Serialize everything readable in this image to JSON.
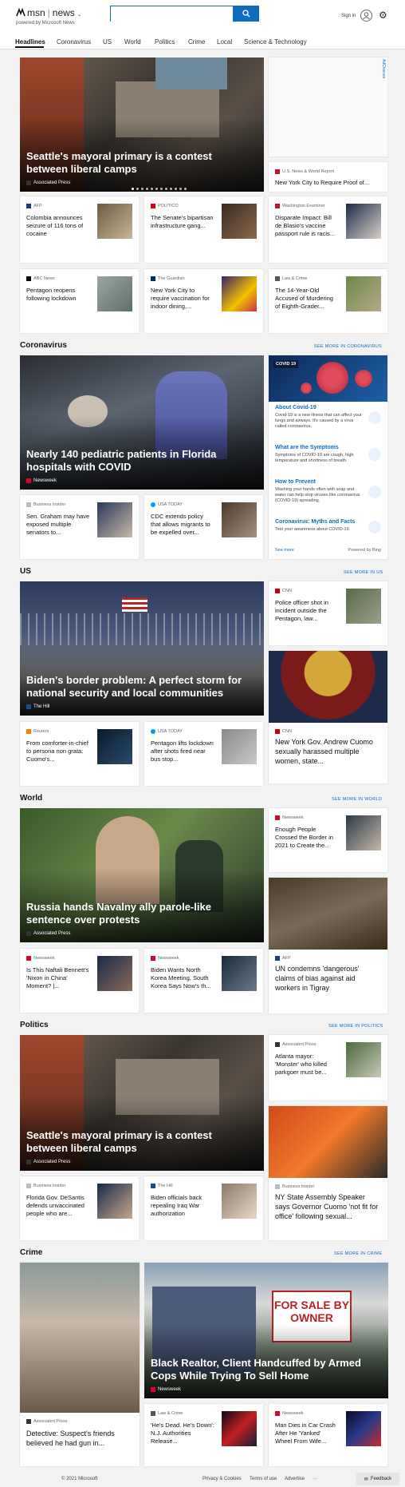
{
  "header": {
    "brand": "msn",
    "section": "news",
    "tagline": "powered by Microsoft News",
    "search_placeholder": "",
    "sign_in": "Sign in"
  },
  "nav": [
    "Headlines",
    "Coronavirus",
    "US",
    "World",
    "Politics",
    "Crime",
    "Local",
    "Science & Technology"
  ],
  "ad_label": "AdChoices",
  "headlines": {
    "hero": {
      "title": "Seattle's mayoral primary is a contest between liberal camps",
      "source": "Associated Press"
    },
    "side": {
      "source": "U.S. News & World Report",
      "title": "New York City to Require Proof of..."
    },
    "row1": [
      {
        "source": "AFP",
        "title": "Colombia announces seizure of 116 tons of cocaine"
      },
      {
        "source": "POLITICO",
        "title": "The Senate's bipartisan infrastructure gang..."
      },
      {
        "source": "Washington Examiner",
        "title": "Disparate Impact: Bill de Blasio's vaccine passport rule is racis..."
      }
    ],
    "row2": [
      {
        "source": "ABC News",
        "title": "Pentagon reopens following lockdown"
      },
      {
        "source": "The Guardian",
        "title": "New York City to require vaccination for indoor dining,..."
      },
      {
        "source": "Law & Crime",
        "title": "The 14-Year-Old Accused of Murdering of Eighth-Grader..."
      }
    ]
  },
  "coronavirus": {
    "heading": "Coronavirus",
    "more": "SEE MORE IN CORONAVIRUS",
    "hero": {
      "title": "Nearly 140 pediatric patients in Florida hospitals with COVID",
      "source": "Newsweek"
    },
    "row": [
      {
        "source": "Business Insider",
        "title": "Sen. Graham may have exposed multiple senators to..."
      },
      {
        "source": "USA TODAY",
        "title": "CDC extends policy that allows migrants to be expelled over..."
      }
    ],
    "panel": {
      "tag": "COVID 19",
      "items": [
        {
          "h": "About Covid-19",
          "d": "Covid-19 is a new illness that can affect your lungs and airways. It's caused by a virus called coronavirus."
        },
        {
          "h": "What are the Symptoms",
          "d": "Symptoms of COVID-19 are cough, high temperature and shortness of breath."
        },
        {
          "h": "How to Prevent",
          "d": "Washing your hands often with soap and water can help stop viruses like coronavirus (COVID-19) spreading."
        },
        {
          "h": "Coronavirus: Myths and Facts",
          "d": "Test your awareness about COVID-19."
        }
      ],
      "see_more": "See more",
      "powered": "Powered by Bing"
    }
  },
  "us": {
    "heading": "US",
    "more": "SEE MORE IN US",
    "hero": {
      "title": "Biden's border problem: A perfect storm for national security and local communities",
      "source": "The Hill"
    },
    "side1": {
      "source": "CNN",
      "title": "Police officer shot in incident outside the Pentagon, law..."
    },
    "side2": {
      "source": "CNN",
      "title": "New York Gov. Andrew Cuomo sexually harassed multiple women, state..."
    },
    "row": [
      {
        "source": "Reuters",
        "title": "From comforter-in-chief to persona non grata: Cuomo's..."
      },
      {
        "source": "USA TODAY",
        "title": "Pentagon lifts lockdown after shots fired near bus stop..."
      }
    ]
  },
  "world": {
    "heading": "World",
    "more": "SEE MORE IN WORLD",
    "hero": {
      "title": "Russia hands Navalny ally parole-like sentence over protests",
      "source": "Associated Press"
    },
    "side1": {
      "source": "Newsweek",
      "title": "Enough People Crossed the Border in 2021 to Create the..."
    },
    "side2": {
      "source": "AFP",
      "title": "UN condemns 'dangerous' claims of bias against aid workers in Tigray"
    },
    "row": [
      {
        "source": "Newsweek",
        "title": "Is This Naftali Bennett's 'Nixon in China' Moment? |..."
      },
      {
        "source": "Newsweek",
        "title": "Biden Wants North Korea Meeting, South Korea Says Now's th..."
      }
    ]
  },
  "politics": {
    "heading": "Politics",
    "more": "SEE MORE IN POLITICS",
    "hero": {
      "title": "Seattle's mayoral primary is a contest between liberal camps",
      "source": "Associated Press"
    },
    "side1": {
      "source": "Associated Press",
      "title": "Atlanta mayor: 'Monster' who killed parkgoer must be..."
    },
    "side2": {
      "source": "Business Insider",
      "title": "NY State Assembly Speaker says Governor Cuomo 'not fit for office' following sexual..."
    },
    "row": [
      {
        "source": "Business Insider",
        "title": "Florida Gov. DeSantis defends unvaccinated people who are..."
      },
      {
        "source": "The Hill",
        "title": "Biden officials back repealing Iraq War authorization"
      }
    ]
  },
  "crime": {
    "heading": "Crime",
    "more": "SEE MORE IN CRIME",
    "left": {
      "source": "Associated Press",
      "title": "Detective: Suspect's friends believed he had gun in..."
    },
    "hero": {
      "title": "Black Realtor, Client Handcuffed by Armed Cops While Trying To Sell Home",
      "source": "Newsweek"
    },
    "sign": "FOR SALE BY OWNER",
    "row": [
      {
        "source": "Law & Crime",
        "title": "'He's Dead. He's Down': N.J. Authorities Release..."
      },
      {
        "source": "Newsweek",
        "title": "Man Dies in Car Crash After He 'Yanked' Wheel From Wife..."
      }
    ]
  },
  "footer": {
    "copyright": "© 2021 Microsoft",
    "links": [
      "Privacy & Cookies",
      "Terms of use",
      "Advertise",
      "···"
    ],
    "feedback": "Feedback"
  },
  "colors": {
    "accent": "#0f6cbd",
    "page_bg": "#f2f2f2"
  }
}
